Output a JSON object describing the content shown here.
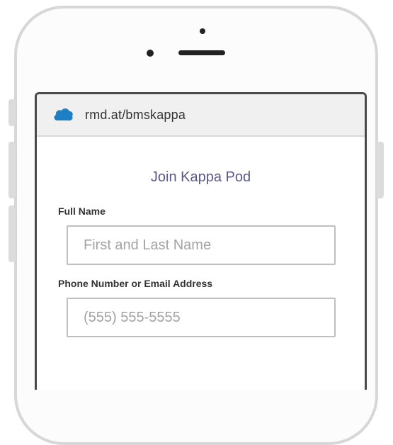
{
  "browser": {
    "url": "rmd.at/bmskappa",
    "icon": "cloud-logo-icon"
  },
  "form": {
    "title": "Join Kappa Pod",
    "full_name_label": "Full Name",
    "full_name_placeholder": "First and Last Name",
    "contact_label": "Phone Number or Email Address",
    "contact_placeholder": "(555) 555-5555"
  },
  "colors": {
    "title": "#5a5a8a",
    "logo": "#1e7fc4"
  }
}
